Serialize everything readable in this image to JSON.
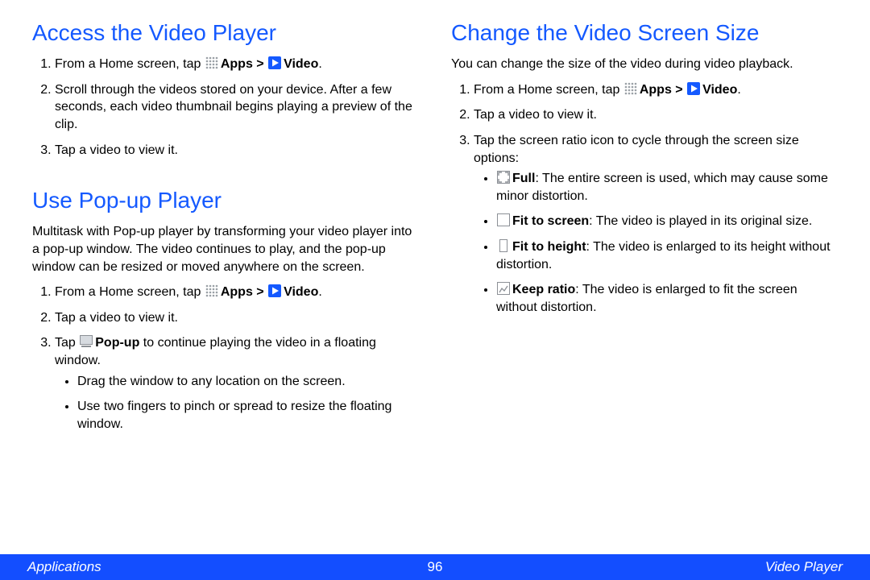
{
  "col_left": {
    "sec1": {
      "heading": "Access the Video Player",
      "items": {
        "i1_pre": "From a Home screen, tap ",
        "i1_apps": "Apps > ",
        "i1_video": "Video",
        "i1_post": ".",
        "i2": "Scroll through the videos stored on your device. After a few seconds, each video thumbnail begins playing a preview of the clip.",
        "i3": "Tap a video to view it."
      }
    },
    "sec2": {
      "heading": "Use Pop-up Player",
      "intro": "Multitask with Pop-up player by transforming your video player into a pop-up window. The video continues to play, and the pop-up window can be resized or moved anywhere on the screen.",
      "items": {
        "i1_pre": "From a Home screen, tap ",
        "i1_apps": "Apps > ",
        "i1_video": "Video",
        "i1_post": ".",
        "i2": "Tap a video to view it.",
        "i3_pre": "Tap ",
        "i3_popup": "Pop-up",
        "i3_post": " to continue playing the video in a floating window.",
        "sub1": "Drag the window to any location on the screen.",
        "sub2": "Use two fingers to pinch or spread to resize the floating window."
      }
    }
  },
  "col_right": {
    "sec1": {
      "heading": "Change the Video Screen Size",
      "intro": "You can change the size of the video during video playback.",
      "items": {
        "i1_pre": "From a Home screen, tap ",
        "i1_apps": "Apps > ",
        "i1_video": "Video",
        "i1_post": ".",
        "i2": "Tap a video to view it.",
        "i3": "Tap the screen ratio icon to cycle through the screen size options:",
        "b1_label": "Full",
        "b1_text": ": The entire screen is used, which may cause some minor distortion.",
        "b2_label": "Fit to screen",
        "b2_text": ": The video is played in its original size.",
        "b3_label": "Fit to height",
        "b3_text": ": The video is enlarged to its height without distortion.",
        "b4_label": "Keep ratio",
        "b4_text": ": The video is enlarged to fit the screen without distortion."
      }
    }
  },
  "footer": {
    "left": "Applications",
    "page": "96",
    "right": "Video Player"
  }
}
